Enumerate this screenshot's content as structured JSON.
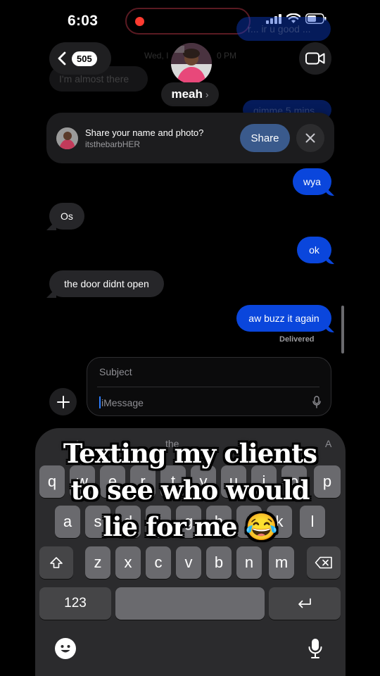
{
  "status": {
    "time": "6:03"
  },
  "header": {
    "back_badge": "505",
    "contact_name": "meah",
    "name_chevron": "›",
    "faint_date": "Wed, I",
    "faint_time": "0 PM"
  },
  "background_messages": {
    "left": "I'm almost there",
    "top_right": "r... ir u good ...",
    "right": "gimme 5 mins"
  },
  "share_banner": {
    "title": "Share your name and photo?",
    "handle": "itsthebarbHER",
    "share_label": "Share"
  },
  "messages": [
    {
      "text": "wya",
      "direction": "out"
    },
    {
      "text": "Os",
      "direction": "in"
    },
    {
      "text": "ok",
      "direction": "out"
    },
    {
      "text": "the door didnt open",
      "direction": "in"
    },
    {
      "text": "aw buzz it again",
      "direction": "out"
    }
  ],
  "delivered": "Delivered",
  "compose": {
    "subject_placeholder": "Subject",
    "message_placeholder": "iMessage"
  },
  "keyboard": {
    "suggestions": [
      "I",
      "the",
      "A"
    ],
    "row1": [
      "q",
      "w",
      "e",
      "r",
      "t",
      "y",
      "u",
      "i",
      "o",
      "p"
    ],
    "row2": [
      "a",
      "s",
      "d",
      "f",
      "g",
      "h",
      "j",
      "k",
      "l"
    ],
    "row3": [
      "z",
      "x",
      "c",
      "v",
      "b",
      "n",
      "m"
    ],
    "numbers_label": "123"
  },
  "caption": {
    "line1": "Texting my clients",
    "line2": "to see who would",
    "line3": "lie for me 😂"
  },
  "colors": {
    "outgoing_bubble": "#0a46dc",
    "incoming_bubble": "#262629",
    "share_button": "#3a5a8c",
    "recording_dot": "#ff3b30"
  }
}
